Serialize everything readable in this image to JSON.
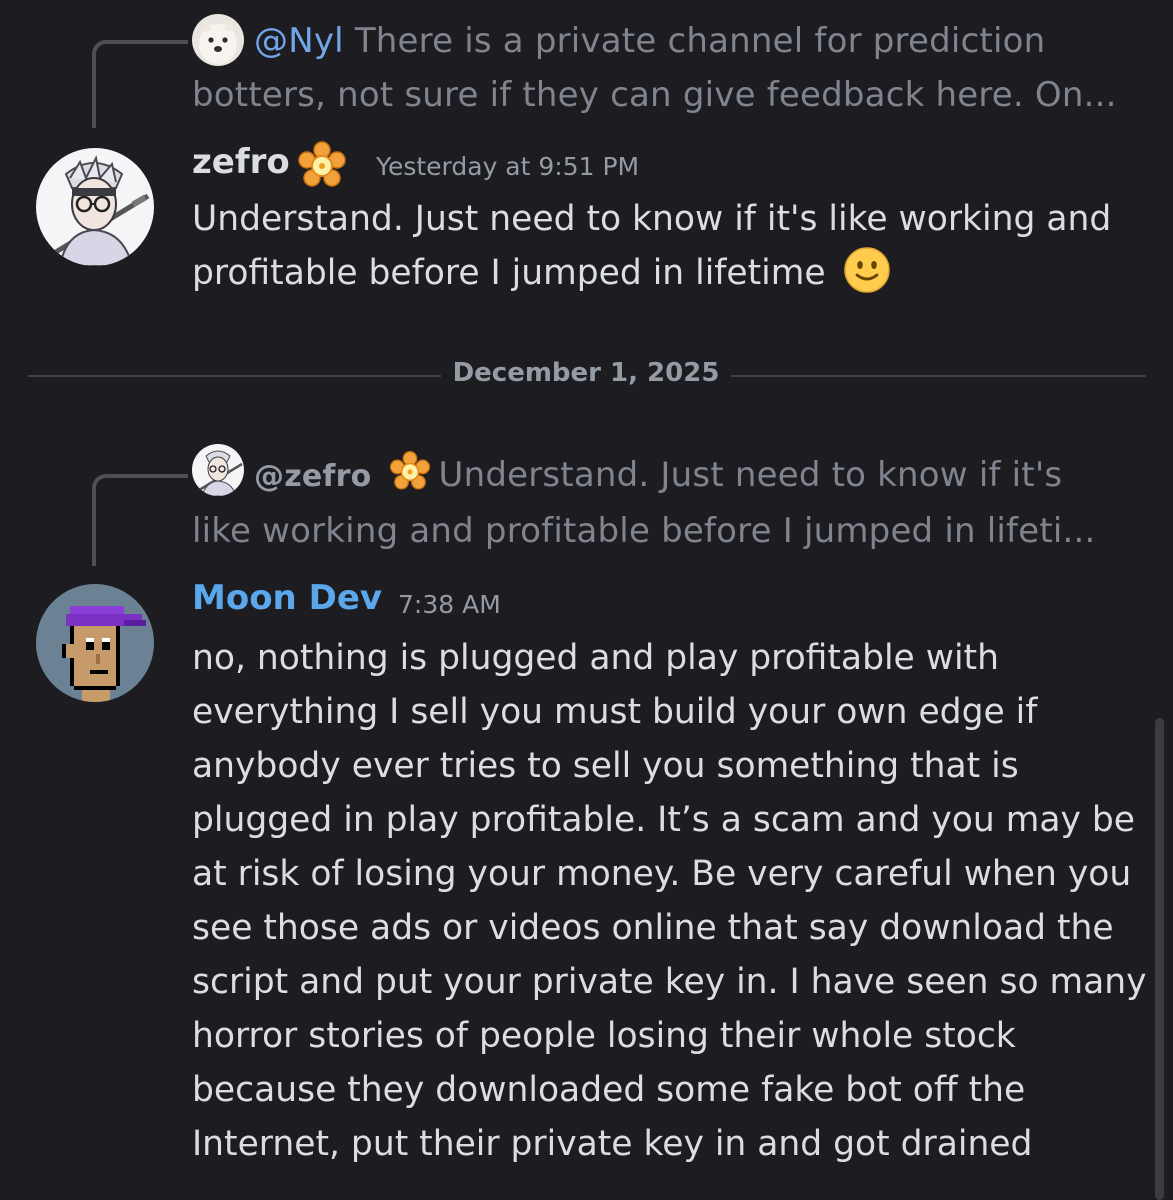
{
  "messages": [
    {
      "reply": {
        "mention": "@Nyl",
        "preview_line1": "There is a private channel for prediction",
        "preview_line2": "botters, not sure if they can give feedback here. On..."
      },
      "author": "zefro",
      "author_badge": "flower-badge-icon",
      "timestamp": "Yesterday at 9:51 PM",
      "text_line1": "Understand. Just need to know if it's like working and",
      "text_line2": "profitable before I jumped in lifetime",
      "text_emoji": "slightly-smiling-face-icon"
    },
    {
      "reply": {
        "mention": "@zefro",
        "mention_badge": "flower-badge-icon",
        "preview_line1": "Understand. Just need to know if it's",
        "preview_line2": "like working and profitable before I jumped in lifeti..."
      },
      "author": "Moon Dev",
      "author_color": "#5ba7ec",
      "timestamp": "7:38 AM",
      "text": "no, nothing is plugged and play profitable with everything I sell you must build your own edge if anybody ever tries to sell you something that is plugged in play profitable. It’s a scam and you may be at risk of losing your money. Be very careful when you see those ads or videos online that say download the script and put your private key in. I have seen so many horror stories of people losing their whole stock because they downloaded some fake bot off the Internet, put their private key in and got drained"
    }
  ],
  "date_divider": "December 1, 2025",
  "colors": {
    "background": "#1c1c21",
    "mention": "#72a6e8",
    "moon_dev_name": "#5ba7ec",
    "text": "#dbdee1",
    "muted": "#80848e"
  }
}
